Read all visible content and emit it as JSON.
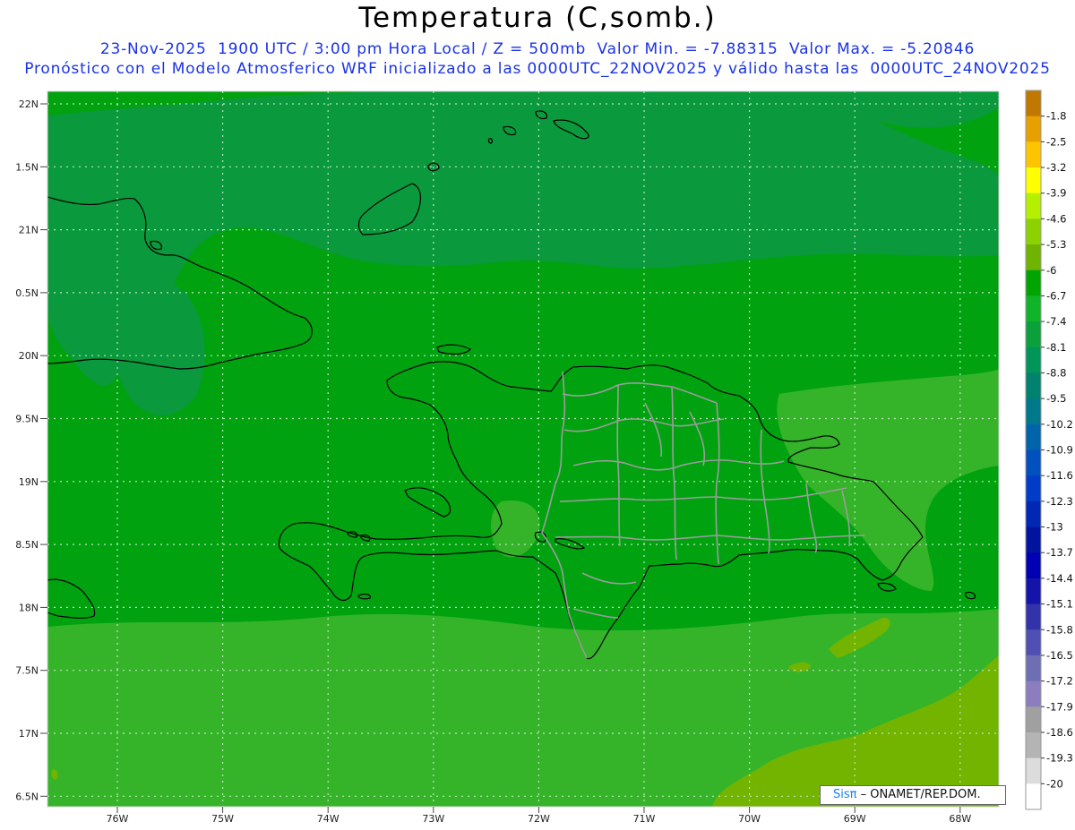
{
  "title": "Temperatura (C,somb.)",
  "subtitle_1": "23-Nov-2025  1900 UTC / 3:00 pm Hora Local / Z = 500mb  Valor Min. = -7.88315  Valor Max. = -5.20846",
  "subtitle_2": "Pronóstico con el Modelo Atmosferico WRF inicializado a las 0000UTC_22NOV2025 y válido hasta las  0000UTC_24NOV2025",
  "lat_labels": [
    "22N",
    "1.5N",
    "21N",
    "0.5N",
    "20N",
    "9.5N",
    "19N",
    "8.5N",
    "18N",
    "7.5N",
    "17N",
    "6.5N"
  ],
  "lon_labels": [
    "76W",
    "75W",
    "74W",
    "73W",
    "72W",
    "71W",
    "70W",
    "69W",
    "68W"
  ],
  "colorbar": {
    "labels": [
      "-1.8",
      "-2.5",
      "-3.2",
      "-3.9",
      "-4.6",
      "-5.3",
      "-6",
      "-6.7",
      "-7.4",
      "-8.1",
      "-8.8",
      "-9.5",
      "-10.2",
      "-10.9",
      "-11.6",
      "-12.3",
      "-13",
      "-13.7",
      "-14.4",
      "-15.1",
      "-15.8",
      "-16.5",
      "-17.2",
      "-17.9",
      "-18.6",
      "-19.3",
      "-20"
    ],
    "colors": [
      "#c07800",
      "#e8a000",
      "#ffc400",
      "#ffff00",
      "#b4f000",
      "#8cd200",
      "#6eb400",
      "#00a500",
      "#10b428",
      "#0aa03c",
      "#00965a",
      "#00826e",
      "#00788c",
      "#0064aa",
      "#0050be",
      "#003cc8",
      "#0028b4",
      "#0014a0",
      "#0000b4",
      "#1414aa",
      "#3232aa",
      "#5050b4",
      "#6e6eb4",
      "#8c7dbe",
      "#a0a0a0",
      "#b4b4b4",
      "#dcdcdc",
      "#ffffff"
    ]
  },
  "field_colors": {
    "base": "#00a30f",
    "dark": "#0a993c",
    "light": "#35b42a",
    "warm": "#72b400",
    "warmer": "#8cc800"
  },
  "credit": {
    "brand": "Sisπ",
    "text": " –  ONAMET/REP.DOM."
  }
}
